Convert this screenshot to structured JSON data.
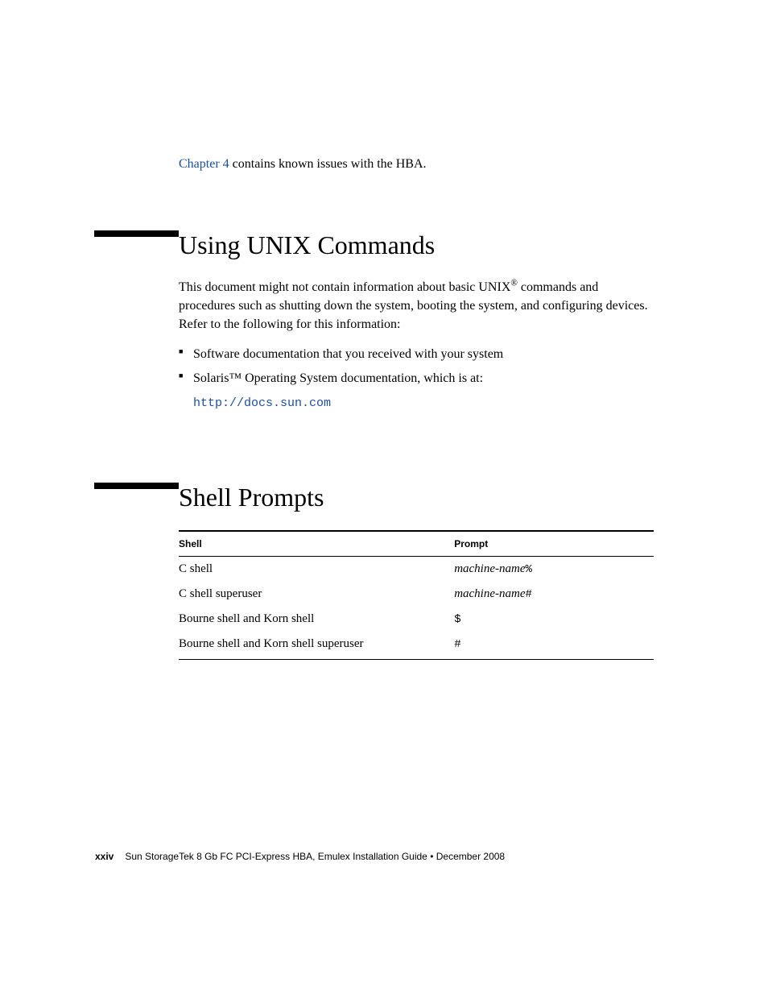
{
  "intro": {
    "link_text": "Chapter 4",
    "rest": " contains known issues with the HBA."
  },
  "section1": {
    "title": "Using UNIX Commands",
    "para_pre": "This document might not contain information about basic UNIX",
    "para_post": " commands and procedures such as shutting down the system, booting the system, and configuring devices. Refer to the following for this information:",
    "bullets": {
      "b1": "Software documentation that you received with your system",
      "b2": "Solaris™ Operating System documentation, which is at:"
    },
    "url": "http://docs.sun.com"
  },
  "section2": {
    "title": "Shell Prompts",
    "headers": {
      "c1": "Shell",
      "c2": "Prompt"
    },
    "rows": {
      "r1": {
        "shell": "C shell",
        "prompt_italic": "machine-name",
        "prompt_sym": "%"
      },
      "r2": {
        "shell": "C shell superuser",
        "prompt_italic": "machine-name",
        "prompt_sym": "#"
      },
      "r3": {
        "shell": "Bourne shell and Korn shell",
        "prompt_sym": "$"
      },
      "r4": {
        "shell": "Bourne shell and Korn shell superuser",
        "prompt_sym": "#"
      }
    }
  },
  "footer": {
    "page": "xxiv",
    "title": "Sun StorageTek 8 Gb FC PCI-Express HBA, Emulex Installation Guide • December 2008"
  }
}
